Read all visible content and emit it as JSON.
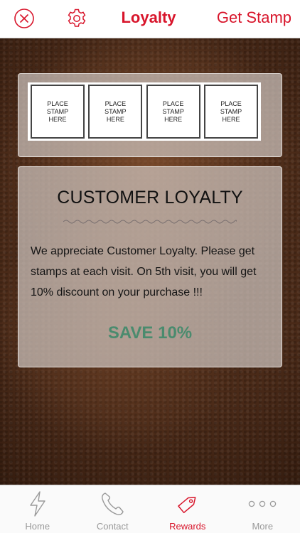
{
  "nav": {
    "title": "Loyalty",
    "action_label": "Get Stamp",
    "close_icon": "close-circle-icon",
    "settings_icon": "gear-icon"
  },
  "stamps": [
    {
      "label": "PLACE\nSTAMP\nHERE",
      "filled": false
    },
    {
      "label": "PLACE\nSTAMP\nHERE",
      "filled": false
    },
    {
      "label": "PLACE\nSTAMP\nHERE",
      "filled": false
    },
    {
      "label": "PLACE\nSTAMP\nHERE",
      "filled": false
    }
  ],
  "loyalty": {
    "title": "CUSTOMER LOYALTY",
    "description": "We appreciate Customer Loyalty. Please get stamps at each visit. On 5th visit, you will get 10% discount on your purchase !!!",
    "offer": "SAVE 10%"
  },
  "tabs": [
    {
      "label": "Home",
      "icon": "lightning-icon",
      "active": false
    },
    {
      "label": "Contact",
      "icon": "phone-icon",
      "active": false
    },
    {
      "label": "Rewards",
      "icon": "tag-icon",
      "active": true
    },
    {
      "label": "More",
      "icon": "more-dots-icon",
      "active": false
    }
  ],
  "colors": {
    "accent": "#d8152b",
    "offer": "#4a8b6e",
    "tab_inactive": "#999999"
  }
}
